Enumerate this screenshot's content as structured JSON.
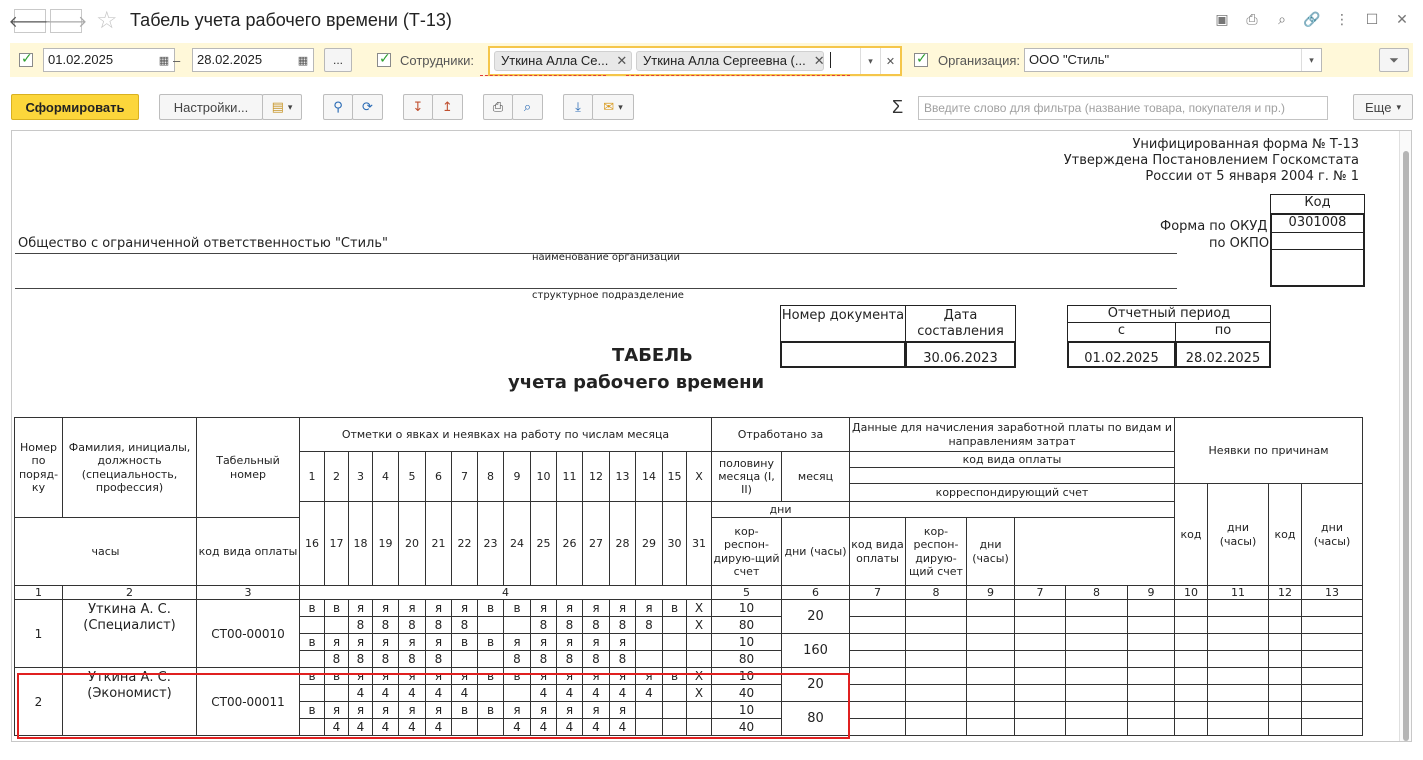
{
  "window": {
    "title": "Табель учета рабочего времени (Т-13)"
  },
  "filters": {
    "date_from": "01.02.2025",
    "dash": "–",
    "date_to": "28.02.2025",
    "period_btn": "...",
    "employees_label": "Сотрудники:",
    "employee_chips": [
      "Уткина Алла Се...",
      "Уткина Алла Сергеевна (..."
    ],
    "org_label": "Организация:",
    "org_value": "ООО \"Стиль\""
  },
  "toolbar": {
    "generate": "Сформировать",
    "settings": "Настройки...",
    "search_placeholder": "Введите слово для фильтра (название товара, покупателя и пр.)",
    "more": "Еще"
  },
  "report": {
    "form_line1": "Унифицированная форма № Т-13",
    "form_line2": "Утверждена Постановлением Госкомстата",
    "form_line3": "России от 5 января 2004 г. № 1",
    "code_header": "Код",
    "okud_label": "Форма по ОКУД",
    "okud_value": "0301008",
    "okpo_label": "по ОКПО",
    "org_name": "Общество с ограниченной ответственностью \"Стиль\"",
    "org_caption": "наименование организации",
    "dept_caption": "структурное подразделение",
    "doc_number_header": "Номер документа",
    "doc_date_header": "Дата составления",
    "doc_date_value": "30.06.2023",
    "period_header": "Отчетный период",
    "period_from_label": "с",
    "period_to_label": "по",
    "period_from": "01.02.2025",
    "period_to": "28.02.2025",
    "title1": "ТАБЕЛЬ",
    "title2": "учета  рабочего времени"
  },
  "table": {
    "h_num": "Номер по поряд-ку",
    "h_name": "Фамилия, инициалы, должность (специальность, профессия)",
    "h_tab": "Табельный номер",
    "h_marks": "Отметки о явках и неявках на работу по числам месяца",
    "h_worked": "Отработано за",
    "h_half": "половину месяца (I, II)",
    "h_month": "месяц",
    "h_days": "дни",
    "h_hours": "часы",
    "h_pay": "Данные для начисления заработной платы по видам и направлениям затрат",
    "h_paycode": "код вида оплаты",
    "h_account": "корреспондирующий счет",
    "h_code_pay": "код вида оплаты",
    "h_corr": "кор-респон-дирую-щий счет",
    "h_dayshours": "дни (часы)",
    "h_absence": "Неявки по причинам",
    "h_code": "код",
    "days_row1": [
      "1",
      "2",
      "3",
      "4",
      "5",
      "6",
      "7",
      "8",
      "9",
      "10",
      "11",
      "12",
      "13",
      "14",
      "15",
      "X"
    ],
    "days_row2": [
      "16",
      "17",
      "18",
      "19",
      "20",
      "21",
      "22",
      "23",
      "24",
      "25",
      "26",
      "27",
      "28",
      "29",
      "30",
      "31"
    ],
    "col_numbers": [
      "1",
      "2",
      "3",
      "4",
      "5",
      "6",
      "7",
      "8",
      "9",
      "7",
      "8",
      "9",
      "10",
      "11",
      "12",
      "13"
    ],
    "employees": [
      {
        "num": "1",
        "name": "Уткина А. С.",
        "position": "(Специалист)",
        "tab": "СТ00-00010",
        "r1": [
          "в",
          "в",
          "я",
          "я",
          "я",
          "я",
          "я",
          "в",
          "в",
          "я",
          "я",
          "я",
          "я",
          "я",
          "в",
          "X"
        ],
        "r2": [
          "",
          "",
          "8",
          "8",
          "8",
          "8",
          "8",
          "",
          "",
          "8",
          "8",
          "8",
          "8",
          "8",
          "",
          "X"
        ],
        "r3": [
          "в",
          "я",
          "я",
          "я",
          "я",
          "я",
          "в",
          "в",
          "я",
          "я",
          "я",
          "я",
          "я",
          "",
          "",
          ""
        ],
        "r4": [
          "",
          "8",
          "8",
          "8",
          "8",
          "8",
          "",
          "",
          "8",
          "8",
          "8",
          "8",
          "8",
          "",
          "",
          ""
        ],
        "h1_days": "10",
        "h1_hours": "80",
        "h2_days": "10",
        "h2_hours": "80",
        "m_days": "20",
        "m_hours": "160"
      },
      {
        "num": "2",
        "name": "Уткина А. С.",
        "position": "(Экономист)",
        "tab": "СТ00-00011",
        "r1": [
          "в",
          "в",
          "я",
          "я",
          "я",
          "я",
          "я",
          "в",
          "в",
          "я",
          "я",
          "я",
          "я",
          "я",
          "в",
          "X"
        ],
        "r2": [
          "",
          "",
          "4",
          "4",
          "4",
          "4",
          "4",
          "",
          "",
          "4",
          "4",
          "4",
          "4",
          "4",
          "",
          "X"
        ],
        "r3": [
          "в",
          "я",
          "я",
          "я",
          "я",
          "я",
          "в",
          "в",
          "я",
          "я",
          "я",
          "я",
          "я",
          "",
          "",
          ""
        ],
        "r4": [
          "",
          "4",
          "4",
          "4",
          "4",
          "4",
          "",
          "",
          "4",
          "4",
          "4",
          "4",
          "4",
          "",
          "",
          ""
        ],
        "h1_days": "10",
        "h1_hours": "40",
        "h2_days": "10",
        "h2_hours": "40",
        "m_days": "20",
        "m_hours": "80"
      }
    ]
  }
}
